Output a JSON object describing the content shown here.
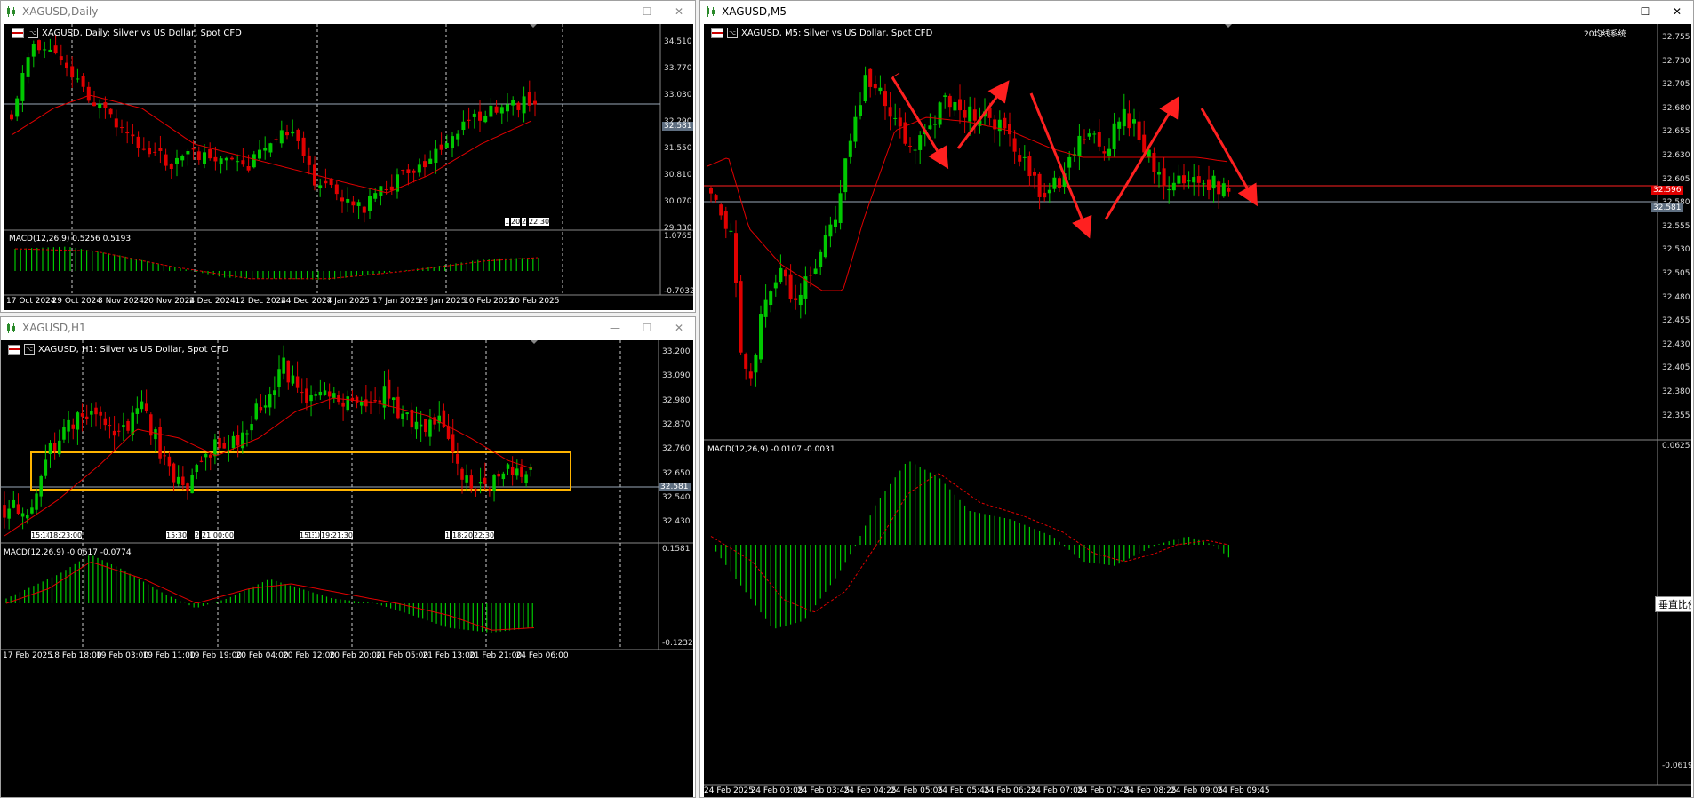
{
  "colors": {
    "bull": "#00c800",
    "bear": "#e00000",
    "ma": "#e00000",
    "grid": "#ffffff",
    "box": "#ffb400",
    "arrow": "#ff2020",
    "bid_line": "#9aa8b8",
    "ask_line": "#ff2020"
  },
  "daily": {
    "title": "XAGUSD,Daily",
    "header": "XAGUSD, Daily:  Silver vs US Dollar, Spot CFD",
    "prices": [
      "34.510",
      "33.770",
      "33.030",
      "32.290",
      "31.550",
      "30.810",
      "30.070",
      "29.330"
    ],
    "current_price": "32.581",
    "macd_label": "MACD(12,26,9) 0.5256 0.5193",
    "macd_scale": [
      "1.0765",
      "-0.7032"
    ],
    "dates": [
      "17 Oct 2024",
      "29 Oct 2024",
      "8 Nov 2024",
      "20 Nov 2024",
      "2 Dec 2024",
      "12 Dec 2024",
      "24 Dec 2024",
      "7 Jan 2025",
      "17 Jan 2025",
      "29 Jan 2025",
      "10 Feb 2025",
      "20 Feb 2025"
    ],
    "markers": [
      "1",
      "20",
      "2",
      "22:30"
    ]
  },
  "h1": {
    "title": "XAGUSD,H1",
    "header": "XAGUSD, H1:  Silver vs US Dollar, Spot CFD",
    "prices": [
      "33.200",
      "33.090",
      "32.980",
      "32.870",
      "32.760",
      "32.650",
      "32.540",
      "32.430"
    ],
    "current_price": "32.581",
    "macd_label": "MACD(12,26,9) -0.0617 -0.0774",
    "macd_scale": [
      "0.1581",
      "-0.1232"
    ],
    "dates": [
      "17 Feb 2025",
      "18 Feb 18:00",
      "19 Feb 03:00",
      "19 Feb 11:00",
      "19 Feb 19:00",
      "20 Feb 04:00",
      "20 Feb 12:00",
      "20 Feb 20:00",
      "21 Feb 05:00",
      "21 Feb 13:00",
      "21 Feb 21:00",
      "24 Feb 06:00"
    ],
    "markers": [
      "15:30",
      "1",
      "18:20:00",
      "23:00",
      "15:30",
      "2",
      "21:00:00",
      "15:30",
      "1",
      "1",
      "19:21:30",
      "1",
      "18:20",
      "22:30"
    ]
  },
  "m5": {
    "title": "XAGUSD,M5",
    "header": "XAGUSD, M5:  Silver vs US Dollar, Spot CFD",
    "corner_label": "20均线系统",
    "prices": [
      "32.755",
      "32.730",
      "32.705",
      "32.680",
      "32.655",
      "32.630",
      "32.605",
      "32.580",
      "32.555",
      "32.530",
      "32.505",
      "32.480",
      "32.455",
      "32.430",
      "32.405",
      "32.380",
      "32.355"
    ],
    "current_price": "32.581",
    "ask_price": "32.596",
    "macd_label": "MACD(12,26,9) -0.0107 -0.0031",
    "macd_scale": [
      "0.0625",
      "-0.0619"
    ],
    "scale_button": "垂直比例",
    "dates": [
      "24 Feb 2025",
      "24 Feb 03:05",
      "24 Feb 03:45",
      "24 Feb 04:25",
      "24 Feb 05:05",
      "24 Feb 05:45",
      "24 Feb 06:25",
      "24 Feb 07:05",
      "24 Feb 07:45",
      "24 Feb 08:25",
      "24 Feb 09:05",
      "24 Feb 09:45"
    ]
  },
  "window_controls": {
    "minimize": "—",
    "maximize": "☐",
    "close": "✕"
  }
}
